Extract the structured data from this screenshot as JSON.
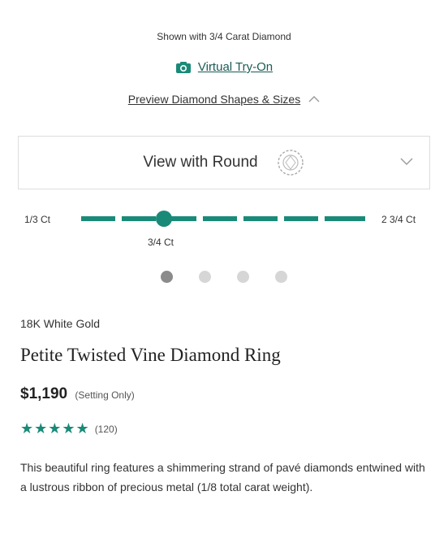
{
  "header": {
    "shown_with": "Shown with 3/4 Carat Diamond",
    "virtual_try_on": "Virtual Try-On",
    "preview_shapes": "Preview Diamond Shapes & Sizes"
  },
  "shape_selector": {
    "label": "View with Round",
    "icon": "round-diamond-icon"
  },
  "carat_slider": {
    "min_label": "1/3 Ct",
    "max_label": "2 3/4 Ct",
    "current_label": "3/4 Ct",
    "current_fraction": 0.29
  },
  "carousel": {
    "dots": 4,
    "active_index": 0
  },
  "product": {
    "metal": "18K White Gold",
    "title": "Petite Twisted Vine Diamond Ring",
    "price": "$1,190",
    "price_note": "(Setting Only)",
    "stars": "★★★★★",
    "rating_count": "(120)",
    "description": "This beautiful ring features a shimmering strand of pavé diamonds entwined with a lustrous ribbon of precious metal (1/8 total carat weight)."
  },
  "colors": {
    "accent": "#1a8a78",
    "link": "#1a5c55"
  }
}
